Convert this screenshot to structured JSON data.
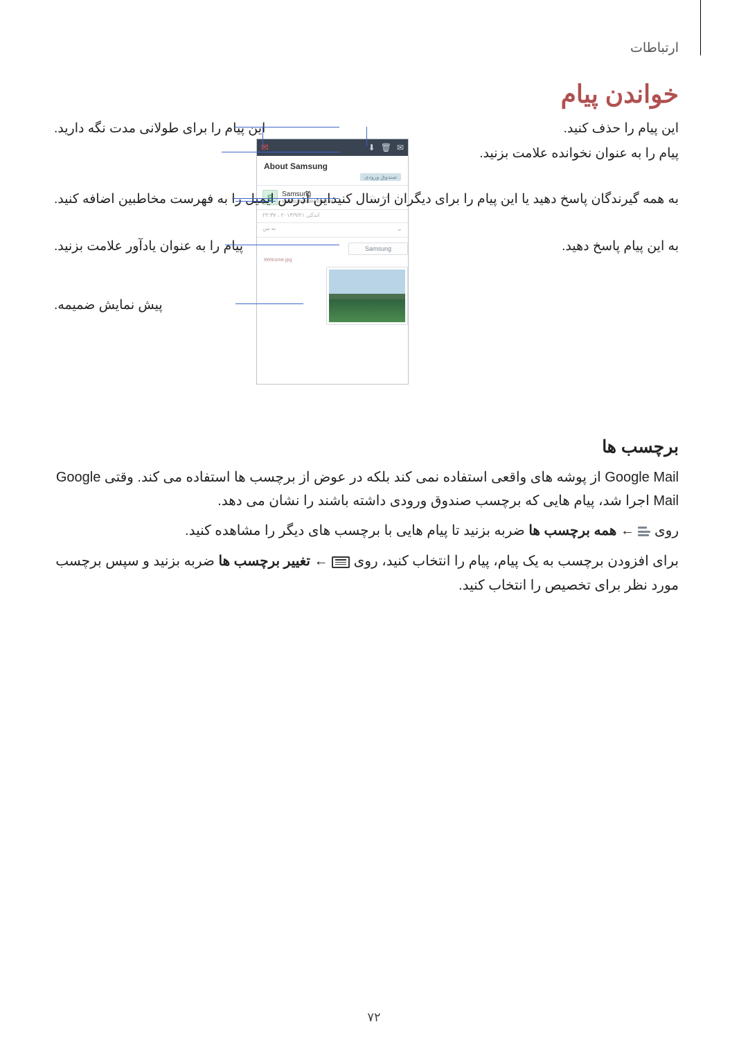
{
  "header": {
    "section": "ارتباطات"
  },
  "title": "خواندن پیام",
  "callouts": {
    "delete": "این پیام را حذف کنید.",
    "mark_unread": "پیام را به عنوان نخوانده علامت بزنید.",
    "reply_all": "به همه گیرندگان پاسخ دهید یا این پیام را برای دیگران ارسال کنید.",
    "reply": "به این پیام پاسخ دهید.",
    "keep_long": "این پیام را برای طولانی مدت نگه دارید.",
    "add_contact": "این آدرس ایمیل را به فهرست مخاطبین اضافه کنید.",
    "reminder": "پیام را به عنوان یادآور علامت بزنید.",
    "preview": "پیش نمایش ضمیمه."
  },
  "phone": {
    "subject": "About Samsung",
    "inbox_chip": "صندوق ورودی",
    "sender_name": "Samsung",
    "sender_email": "samsungusermanual...",
    "date_line": "اندکی ۲۰۱۳/۹/۲۱ ، ۲۲:۳۷",
    "to_line": "به من",
    "reply_tab": "Samsung",
    "tiny_label": "Welcome.jpg"
  },
  "labels_section": {
    "title": "برچسب ها",
    "p1": "Google Mail از پوشه های واقعی استفاده نمی کند بلکه در عوض از برچسب ها استفاده می کند. وقتی Google Mail اجرا شد، پیام هایی که برچسب صندوق ورودی داشته باشند را نشان می دهد.",
    "p2_pre": "روی ",
    "p2_mid": " ← ",
    "p2_bold": "همه برچسب ها",
    "p2_post": " ضربه بزنید تا پیام هایی با برچسب های دیگر را مشاهده کنید.",
    "p3_pre": "برای افزودن برچسب به یک پیام، پیام را انتخاب کنید، روی ",
    "p3_mid": " ← ",
    "p3_bold": "تغییر برچسب ها",
    "p3_post": " ضربه بزنید و سپس برچسب مورد نظر برای تخصیص را انتخاب کنید."
  },
  "page_number": "۷۲"
}
